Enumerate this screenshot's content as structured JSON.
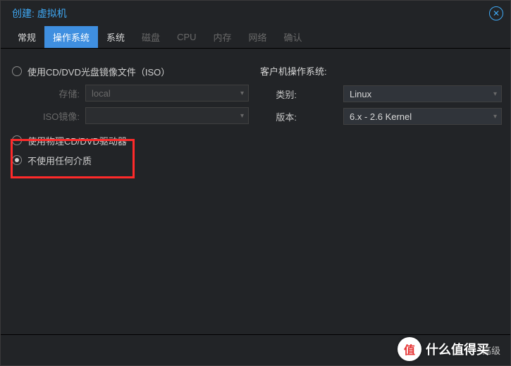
{
  "title": "创建: 虚拟机",
  "tabs": {
    "general": "常规",
    "os": "操作系统",
    "system": "系统",
    "disk": "磁盘",
    "cpu": "CPU",
    "memory": "内存",
    "network": "网络",
    "confirm": "确认"
  },
  "left": {
    "opt_iso": "使用CD/DVD光盘镜像文件（ISO）",
    "storage_label": "存储:",
    "storage_value": "local",
    "iso_label": "ISO镜像:",
    "iso_value": "",
    "opt_physical": "使用物理CD/DVD驱动器",
    "opt_nomedia": "不使用任何介质"
  },
  "right": {
    "header": "客户机操作系统:",
    "category_label": "类别:",
    "category_value": "Linux",
    "version_label": "版本:",
    "version_value": "6.x - 2.6 Kernel"
  },
  "footer": {
    "advanced": "高级"
  },
  "watermark": {
    "badge": "值",
    "text": "什么值得买"
  }
}
